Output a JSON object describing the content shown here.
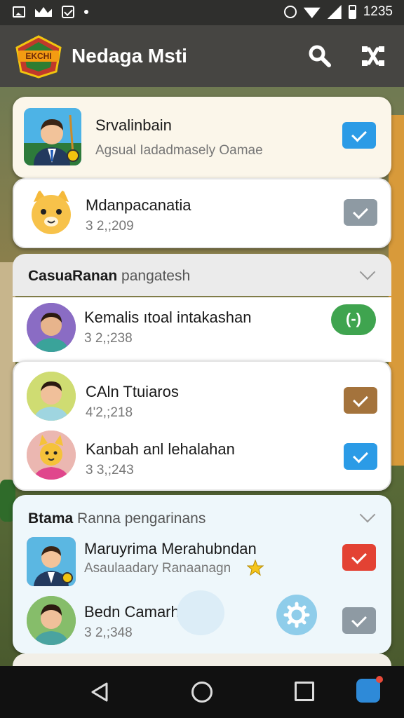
{
  "status_bar": {
    "time": "1235"
  },
  "app_bar": {
    "title": "Nedaga Msti",
    "logo_text": "EKCHI"
  },
  "colors": {
    "checkbox_blue": "#2b9be6",
    "checkbox_gray": "#8e9aa3",
    "checkbox_brown": "#a4733c",
    "checkbox_red": "#e34233",
    "toggle_green": "#3fa44f"
  },
  "top_items": [
    {
      "title": "Srvalinbain",
      "subtitle": "Agsual Iadadmasely Oamae",
      "checked": true,
      "icon": "man-suit-avatar"
    },
    {
      "title": "Mdanpacanatia",
      "subtitle": "3 2,;209",
      "checked": true,
      "icon": "cat-avatar"
    }
  ],
  "section_1": {
    "title_bold": "CasuaRanan",
    "title_rest": " pangatesh",
    "items": [
      {
        "title": "Kemalis ıtoal intakashan",
        "subtitle": "3 2,;238",
        "control": "toggle",
        "toggle_label": "(-)"
      },
      {
        "title": "CAln Ttuiaros",
        "subtitle": "4'2,;218",
        "checked": true
      },
      {
        "title": "Kanbah anl lehalahan",
        "subtitle": "3 3,;243",
        "checked": true
      }
    ]
  },
  "section_2": {
    "title_bold": "Btama",
    "title_rest": " Ranna pengarinans",
    "items": [
      {
        "title": "Maruyrima Merahubndan",
        "subtitle": "Asaulaadary Ranaanagn",
        "checked": true
      },
      {
        "title": "Bedn Camarhagn",
        "subtitle": "3 2,;348",
        "checked": true
      }
    ]
  }
}
